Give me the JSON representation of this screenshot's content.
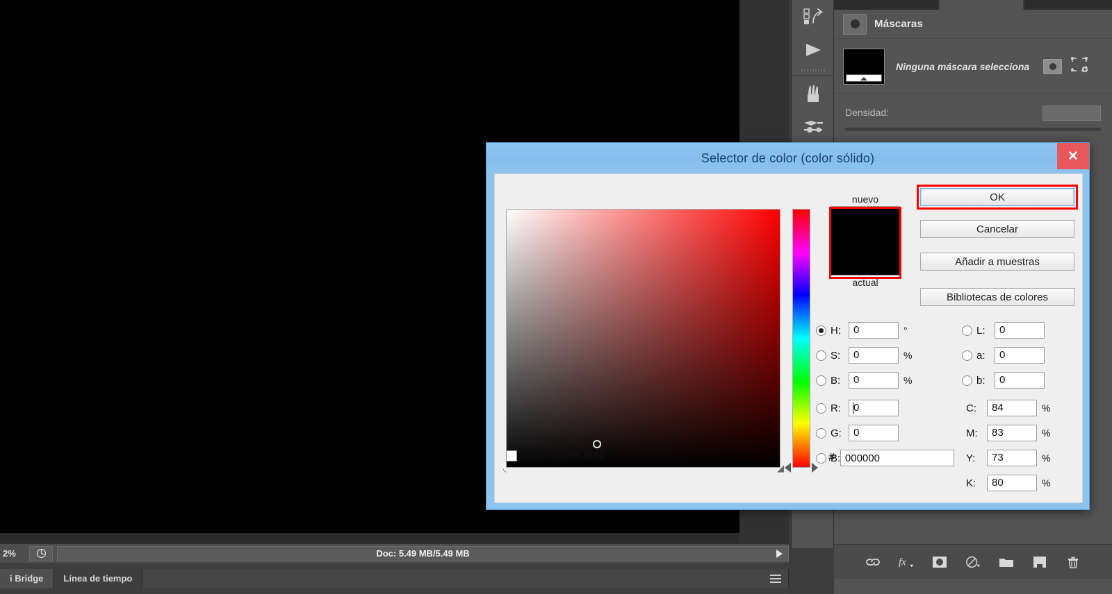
{
  "app": {
    "statusbar": {
      "zoom": "2%",
      "doc_info": "Doc: 5.49 MB/5.49 MB",
      "doc_arrow_icon": "play-triangle-icon",
      "status_icon": "document-icon"
    },
    "bottom_tabs": [
      {
        "label": "i Bridge",
        "selected": true
      },
      {
        "label": "Línea de tiempo",
        "selected": false
      }
    ],
    "menu_icon": "hamburger-menu-icon"
  },
  "icon_dock": {
    "items": [
      {
        "icon": "history-icon"
      },
      {
        "icon": "actions-play-icon"
      },
      {
        "icon": "brush-presets-icon"
      },
      {
        "icon": "tool-presets-icon"
      }
    ]
  },
  "masks_panel": {
    "title": "Máscaras",
    "title_icon": "mask-icon",
    "mask_status": "Ninguna máscara selecciona",
    "thumbnail_icon": "layer-thumbnail-icon",
    "add_pixel_mask_icon": "add-pixel-mask-icon",
    "add_vector_mask_icon": "add-vector-mask-icon",
    "density_label": "Densidad:",
    "density_value": ""
  },
  "layer_actions": {
    "icons": [
      "link-layers-icon",
      "layer-style-fx-icon",
      "add-layer-mask-icon",
      "adjustment-layer-icon",
      "new-group-folder-icon",
      "new-layer-icon",
      "delete-layer-trash-icon"
    ]
  },
  "dialog": {
    "title": "Selector de color (color sólido)",
    "close_icon": "close-x-icon",
    "buttons": {
      "ok": "OK",
      "cancel": "Cancelar",
      "add_swatch": "Añadir a muestras",
      "color_libraries": "Bibliotecas de colores"
    },
    "swatch": {
      "new_label": "nuevo",
      "current_label": "actual",
      "new_color": "#000000",
      "current_color": "#000000"
    },
    "web_only": {
      "label": "Solo colores Web",
      "checked": false
    },
    "hex": {
      "symbol": "#",
      "value": "000000"
    },
    "hsb": [
      {
        "key": "H:",
        "value": "0",
        "unit": "°",
        "selected": true
      },
      {
        "key": "S:",
        "value": "0",
        "unit": "%",
        "selected": false
      },
      {
        "key": "B:",
        "value": "0",
        "unit": "%",
        "selected": false
      }
    ],
    "lab": [
      {
        "key": "L:",
        "value": "0",
        "unit": "",
        "selected": false
      },
      {
        "key": "a:",
        "value": "0",
        "unit": "",
        "selected": false
      },
      {
        "key": "b:",
        "value": "0",
        "unit": "",
        "selected": false
      }
    ],
    "rgb": [
      {
        "key": "R:",
        "value": "0",
        "unit": "",
        "selected": false,
        "caret": true
      },
      {
        "key": "G:",
        "value": "0",
        "unit": "",
        "selected": false,
        "caret": false
      },
      {
        "key": "B:",
        "value": "0",
        "unit": "",
        "selected": false,
        "caret": false
      }
    ],
    "cmyk": [
      {
        "key": "C:",
        "value": "84",
        "unit": "%"
      },
      {
        "key": "M:",
        "value": "83",
        "unit": "%"
      },
      {
        "key": "Y:",
        "value": "73",
        "unit": "%"
      },
      {
        "key": "K:",
        "value": "80",
        "unit": "%"
      }
    ],
    "color_field": {
      "marker_x_pct": 33,
      "marker_y_pct": 91,
      "hue_position_pct": 100
    },
    "annotation_color": "#ff0000"
  }
}
